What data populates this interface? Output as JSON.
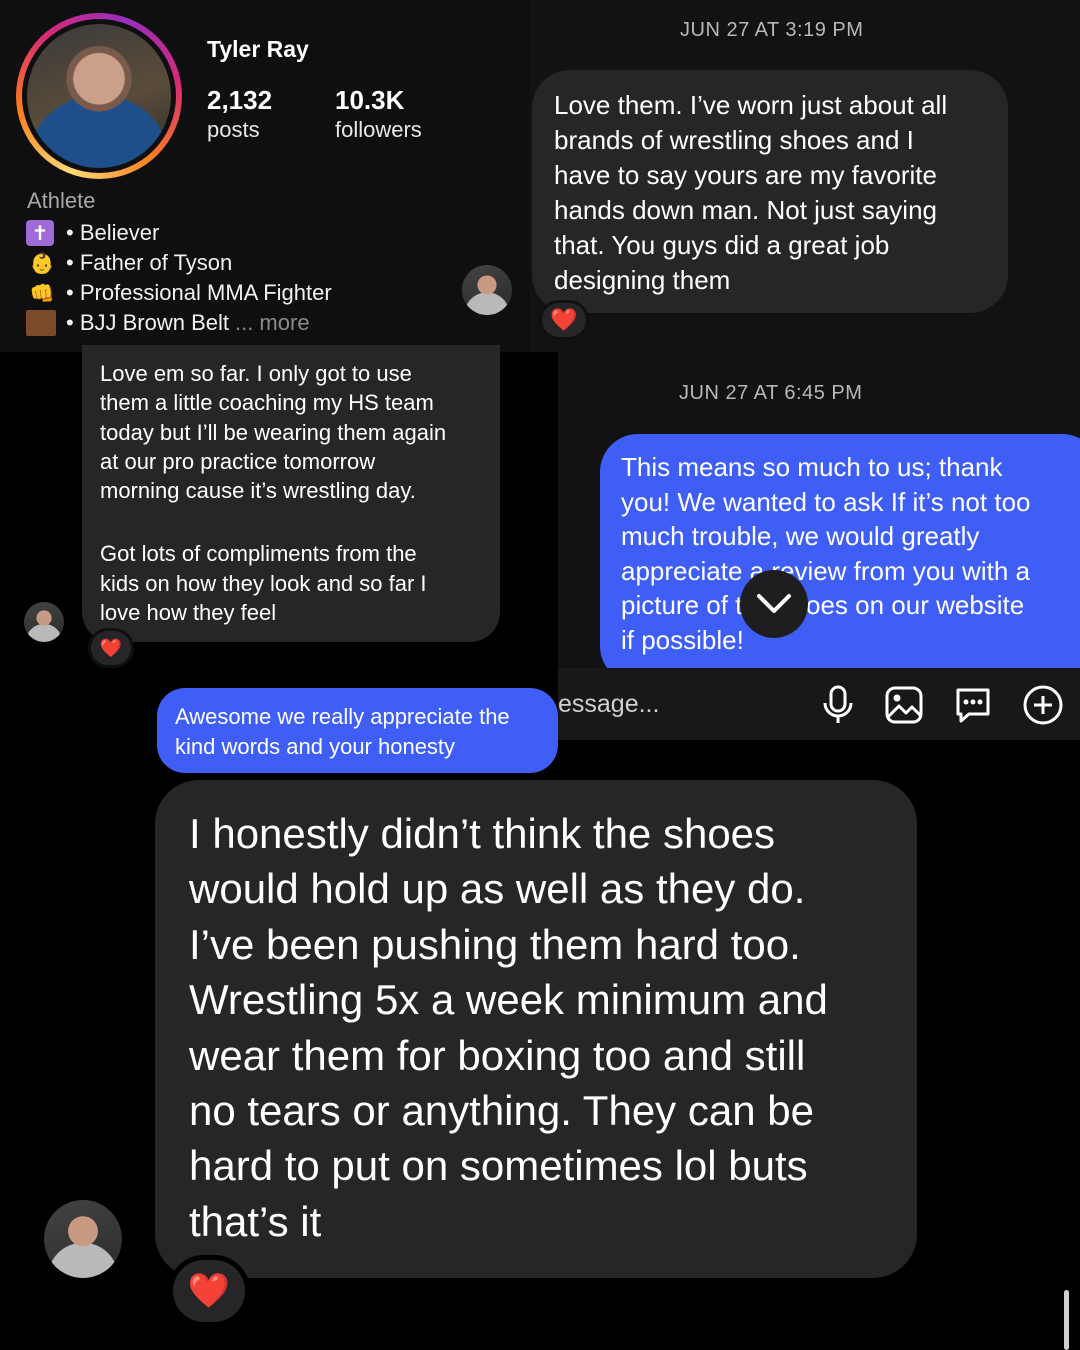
{
  "profile": {
    "name": "Tyler Ray",
    "posts_count": "2,132",
    "posts_label": "posts",
    "followers_count": "10.3K",
    "followers_label": "followers",
    "category": "Athlete",
    "bio": [
      {
        "icon": "cross-icon",
        "emoji": "✝️",
        "text": "• Believer"
      },
      {
        "icon": "baby-icon",
        "emoji": "👶",
        "text": "• Father of Tyson"
      },
      {
        "icon": "fist-icon",
        "emoji": "👊",
        "text": "• Professional MMA Fighter"
      },
      {
        "icon": "brown-square-icon",
        "emoji": "",
        "text": "• BJJ Brown Belt"
      }
    ],
    "more_label": "... more"
  },
  "thread_right": {
    "timestamp_1": "JUN 27 AT 3:19 PM",
    "msg_1": "Love them. I’ve worn just about all\nbrands of wrestling shoes and I\nhave to say yours are my favorite\nhands down man. Not just saying\nthat. You guys did a great job\ndesigning them",
    "timestamp_2": "JUN 27 AT 6:45 PM",
    "msg_2": "This means so much to us; thank\nyou! We wanted to ask If it’s not too\nmuch trouble, we would greatly\nappreciate a review from you with a\npicture of the shoes on our website\nif possible!",
    "composer_placeholder": "essage..."
  },
  "thread_left": {
    "msg_3a": "Love em so far. I only got to use\nthem a little coaching my HS team\ntoday but I’ll be wearing them again\nat our pro practice tomorrow\nmorning cause it’s wrestling day.",
    "msg_3b": "Got lots of compliments from the\nkids on how they look and so far I\nlove how they feel",
    "msg_4": "Awesome we really appreciate the\nkind words and your honesty"
  },
  "thread_bottom": {
    "msg_5": "I honestly didn’t think the shoes\nwould hold up as well as they do.\nI’ve been pushing them hard too.\nWrestling 5x a week minimum and\nwear them for boxing too and still\nno tears or anything. They can be\nhard to put on sometimes lol buts\nthat’s it"
  },
  "reactions": {
    "heart": "❤️"
  },
  "colors": {
    "sent_bubble": "#3e5ef5",
    "received_bubble": "#262628",
    "background": "#000000"
  }
}
